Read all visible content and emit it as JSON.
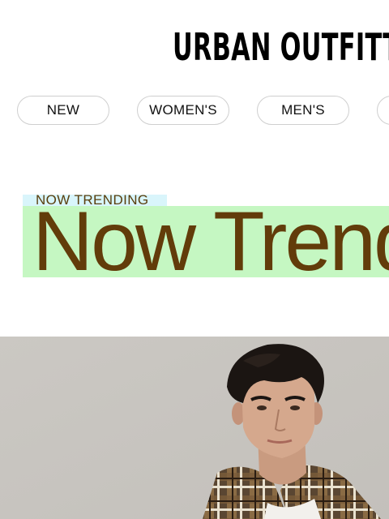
{
  "header": {
    "logo_text": "URBAN OUTFITTERS"
  },
  "nav": {
    "items": [
      {
        "label": "NEW"
      },
      {
        "label": "WOMEN'S"
      },
      {
        "label": "MEN'S"
      },
      {
        "label": ""
      }
    ]
  },
  "hero": {
    "eyebrow": "NOW TRENDING",
    "headline": "Now Trending",
    "image_alt": "Model wearing a plaid flannel shirt over a white tee",
    "colors": {
      "eyebrow_highlight": "#d9f5fb",
      "headline_highlight": "#c5f7c2",
      "text": "#623c0a",
      "image_background": "#c9c6c1"
    }
  }
}
